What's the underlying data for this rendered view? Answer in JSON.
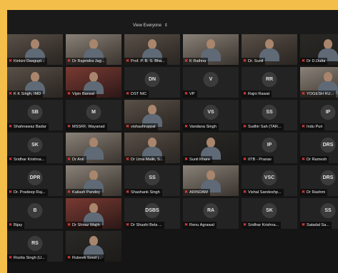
{
  "header": {
    "view_button_label": "View Everyone",
    "view_icon": "chevron-updown-icon"
  },
  "participants": [
    {
      "name": "Kinkini Dasgupt...",
      "initials": "",
      "video": true
    },
    {
      "name": "Dr Rajendra Jag...",
      "initials": "",
      "video": true
    },
    {
      "name": "Prof. P. B. S. Bha...",
      "initials": "",
      "video": true
    },
    {
      "name": "K Rathna",
      "initials": "",
      "video": true
    },
    {
      "name": "Dr. Sunil",
      "initials": "",
      "video": true
    },
    {
      "name": "Dr D.Dutta",
      "initials": "",
      "video": true
    },
    {
      "name": "K K Singh, IMD",
      "initials": "",
      "video": true
    },
    {
      "name": "Vipin Bansal",
      "initials": "",
      "video": true
    },
    {
      "name": "DST NIC",
      "initials": "DN",
      "video": false
    },
    {
      "name": "VP",
      "initials": "V",
      "video": false
    },
    {
      "name": "Rajni Rawat",
      "initials": "RR",
      "video": false
    },
    {
      "name": "YOGESH KU...",
      "initials": "",
      "video": true
    },
    {
      "name": "Shahnawaz Badar",
      "initials": "SB",
      "video": false
    },
    {
      "name": "MSSRF, Wayanad",
      "initials": "M",
      "video": false
    },
    {
      "name": "vishashruppal",
      "initials": "",
      "video": true
    },
    {
      "name": "Vandana Singh",
      "initials": "VS",
      "video": false
    },
    {
      "name": "Sudhir Sah (TAR...",
      "initials": "SS",
      "video": false
    },
    {
      "name": "Indu Puri",
      "initials": "IP",
      "video": false
    },
    {
      "name": "Sridhar Krishna...",
      "initials": "SK",
      "video": false
    },
    {
      "name": "Dr Anil",
      "initials": "",
      "video": true
    },
    {
      "name": "Dr Uma Malik, S...",
      "initials": "",
      "video": true
    },
    {
      "name": "Sunil Khare",
      "initials": "",
      "video": true
    },
    {
      "name": "IITB - Pranav",
      "initials": "IP",
      "video": false
    },
    {
      "name": "Dr Ramesh",
      "initials": "DRS",
      "video": false
    },
    {
      "name": "Dr. Pradeep Raj...",
      "initials": "DPR",
      "video": false
    },
    {
      "name": "Kailash Pandey",
      "initials": "",
      "video": true
    },
    {
      "name": "Shashank Singh",
      "initials": "SS",
      "video": false
    },
    {
      "name": "ARINDAM",
      "initials": "",
      "video": true
    },
    {
      "name": "Vishal Sandeshp...",
      "initials": "VSC",
      "video": false
    },
    {
      "name": "Dr Rashmi",
      "initials": "DRS",
      "video": false
    },
    {
      "name": "Bijay",
      "initials": "B",
      "video": false
    },
    {
      "name": "Dr Shiraz Wajih",
      "initials": "",
      "video": true
    },
    {
      "name": "Dr Shashi Bela ...",
      "initials": "DSBS",
      "video": false
    },
    {
      "name": "Renu Agrawal",
      "initials": "RA",
      "video": false
    },
    {
      "name": "Sridhar Krishna...",
      "initials": "SK",
      "video": false
    },
    {
      "name": "Satadal Sa...",
      "initials": "SS",
      "video": false
    },
    {
      "name": "Rozita Singh (U...",
      "initials": "RS",
      "video": false
    },
    {
      "name": "Rubeek Sood |...",
      "initials": "",
      "video": true
    }
  ]
}
